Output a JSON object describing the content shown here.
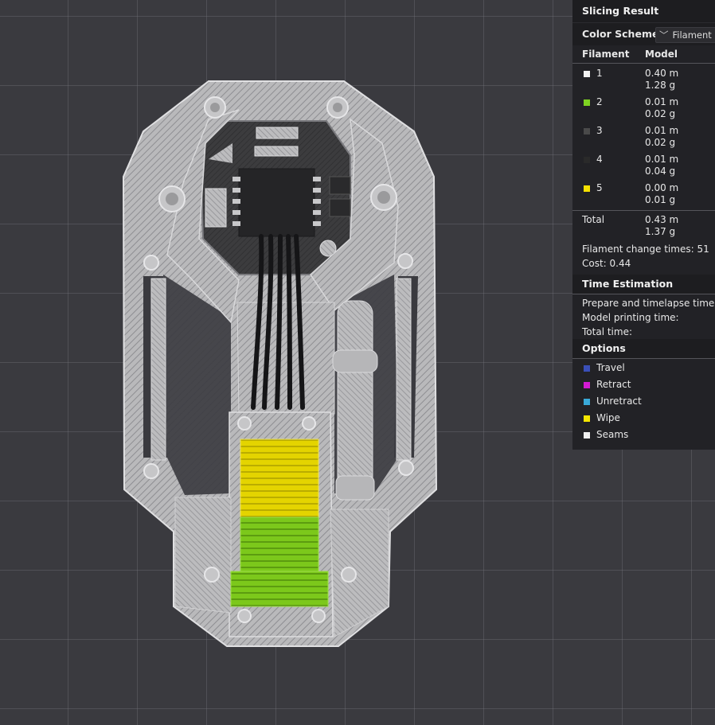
{
  "panel": {
    "slicing_result_title": "Slicing Result",
    "color_scheme_label": "Color Scheme",
    "color_scheme_value": "Filament",
    "columns": {
      "filament": "Filament",
      "model": "Model"
    },
    "filaments": [
      {
        "num": "1",
        "color": "#f2f2f2",
        "length": "0.40 m",
        "weight": "1.28 g"
      },
      {
        "num": "2",
        "color": "#7ed321",
        "length": "0.01 m",
        "weight": "0.02 g"
      },
      {
        "num": "3",
        "color": "#4a4a4a",
        "length": "0.01 m",
        "weight": "0.02 g"
      },
      {
        "num": "4",
        "color": "#2a2a2a",
        "length": "0.01 m",
        "weight": "0.04 g"
      },
      {
        "num": "5",
        "color": "#f5e000",
        "length": "0.00 m",
        "weight": "0.01 g"
      }
    ],
    "total": {
      "label": "Total",
      "length": "0.43 m",
      "weight": "1.37 g"
    },
    "filament_change": "Filament change times:  51",
    "cost": "Cost:  0.44",
    "time_estimation_title": "Time Estimation",
    "time_rows": [
      "Prepare and timelapse time:",
      "Model printing time:",
      "Total time:"
    ],
    "options_title": "Options",
    "options": [
      {
        "label": "Travel",
        "color": "#3a4fb8"
      },
      {
        "label": "Retract",
        "color": "#d31ad3"
      },
      {
        "label": "Unretract",
        "color": "#39a9d8"
      },
      {
        "label": "Wipe",
        "color": "#f5e600"
      },
      {
        "label": "Seams",
        "color": "#f0f0f0"
      }
    ]
  }
}
